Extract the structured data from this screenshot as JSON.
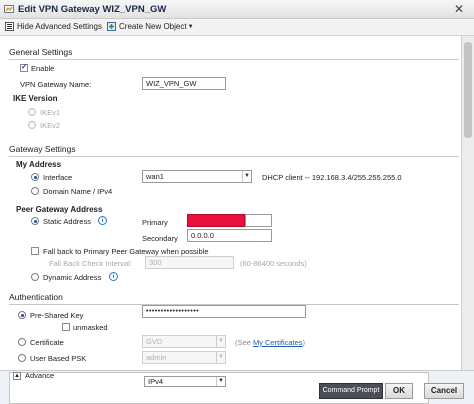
{
  "window": {
    "title": "Edit VPN Gateway WIZ_VPN_GW",
    "close_glyph": "✕"
  },
  "toolbar": {
    "hide_advanced": "Hide Advanced Settings",
    "create_new": "Create New Object"
  },
  "general": {
    "heading": "General Settings",
    "enable_label": "Enable",
    "enable_checked": true,
    "name_label": "VPN Gateway Name:",
    "name_value": "WIZ_VPN_GW",
    "ike_heading": "IKE Version",
    "ikev1": "IKEv1",
    "ikev2": "IKEv2"
  },
  "gateway": {
    "heading": "Gateway Settings",
    "my_address": "My Address",
    "interface_label": "Interface",
    "interface_value": "wan1",
    "dhcp_text": "DHCP client -- 192.168.3.4/255.255.255.0",
    "domain_label": "Domain Name / IPv4",
    "peer_heading": "Peer Gateway Address",
    "static_label": "Static Address",
    "primary_label": "Primary",
    "secondary_label": "Secondary",
    "secondary_value": "0.0.0.0",
    "fallback_label": "Fall back to Primary Peer Gateway when possible",
    "fallback_interval_label": "Fall Back Check Interval:",
    "fallback_interval_value": "300",
    "fallback_range": "(60-86400 seconds)",
    "dynamic_label": "Dynamic Address"
  },
  "auth": {
    "heading": "Authentication",
    "psk_label": "Pre-Shared Key",
    "psk_value": "••••••••••••••••••",
    "unmasked_label": "unmasked",
    "cert_label": "Certificate",
    "cert_value": "GVD",
    "see_prefix": "(See ",
    "see_link": "My Certificates",
    "see_suffix": ")",
    "user_psk_label": "User Based PSK",
    "user_psk_value": "admin"
  },
  "advance": {
    "label": "Advance",
    "local_id_value": "IPv4"
  },
  "buttons": {
    "command_prompt": "Command Prompt",
    "ok": "OK",
    "cancel": "Cancel"
  },
  "colors": {
    "accent": "#1c4f9b",
    "primary_field_error": "#e8103f",
    "link": "#1d5fb8"
  },
  "icons": [
    "vpn-gateway-icon",
    "hide-advanced-icon",
    "create-object-icon",
    "info-icon",
    "close-icon",
    "collapse-icon"
  ]
}
